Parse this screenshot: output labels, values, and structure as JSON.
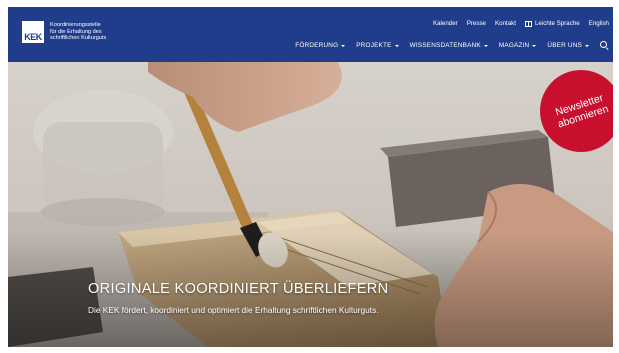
{
  "logo": {
    "mark": "KEK",
    "line1": "Koordinierungsstelle",
    "line2": "für die Erhaltung des",
    "line3": "schriftlichen Kulturguts"
  },
  "utility_nav": {
    "kalender": "Kalender",
    "presse": "Presse",
    "kontakt": "Kontakt",
    "leichte_sprache": "Leichte Sprache",
    "english": "English"
  },
  "main_nav": [
    {
      "label": "FÖRDERUNG"
    },
    {
      "label": "PROJEKTE"
    },
    {
      "label": "WISSENSDATENBANK"
    },
    {
      "label": "MAGAZIN"
    },
    {
      "label": "ÜBER UNS"
    }
  ],
  "hero": {
    "headline": "ORIGINALE KOORDINIERT ÜBERLIEFERN",
    "subline": "Die KEK fördert, koordiniert und optimiert die Erhaltung schriftlichen Kulturguts."
  },
  "badge": {
    "line1": "Newsletter",
    "line2": "abonnieren"
  },
  "icons": {
    "leichte_sprache": "book-icon",
    "search": "search-icon",
    "menu_caret": "chevron-down-icon"
  },
  "colors": {
    "header_bg": "#1f3d8a",
    "badge_bg": "#c8102e"
  }
}
